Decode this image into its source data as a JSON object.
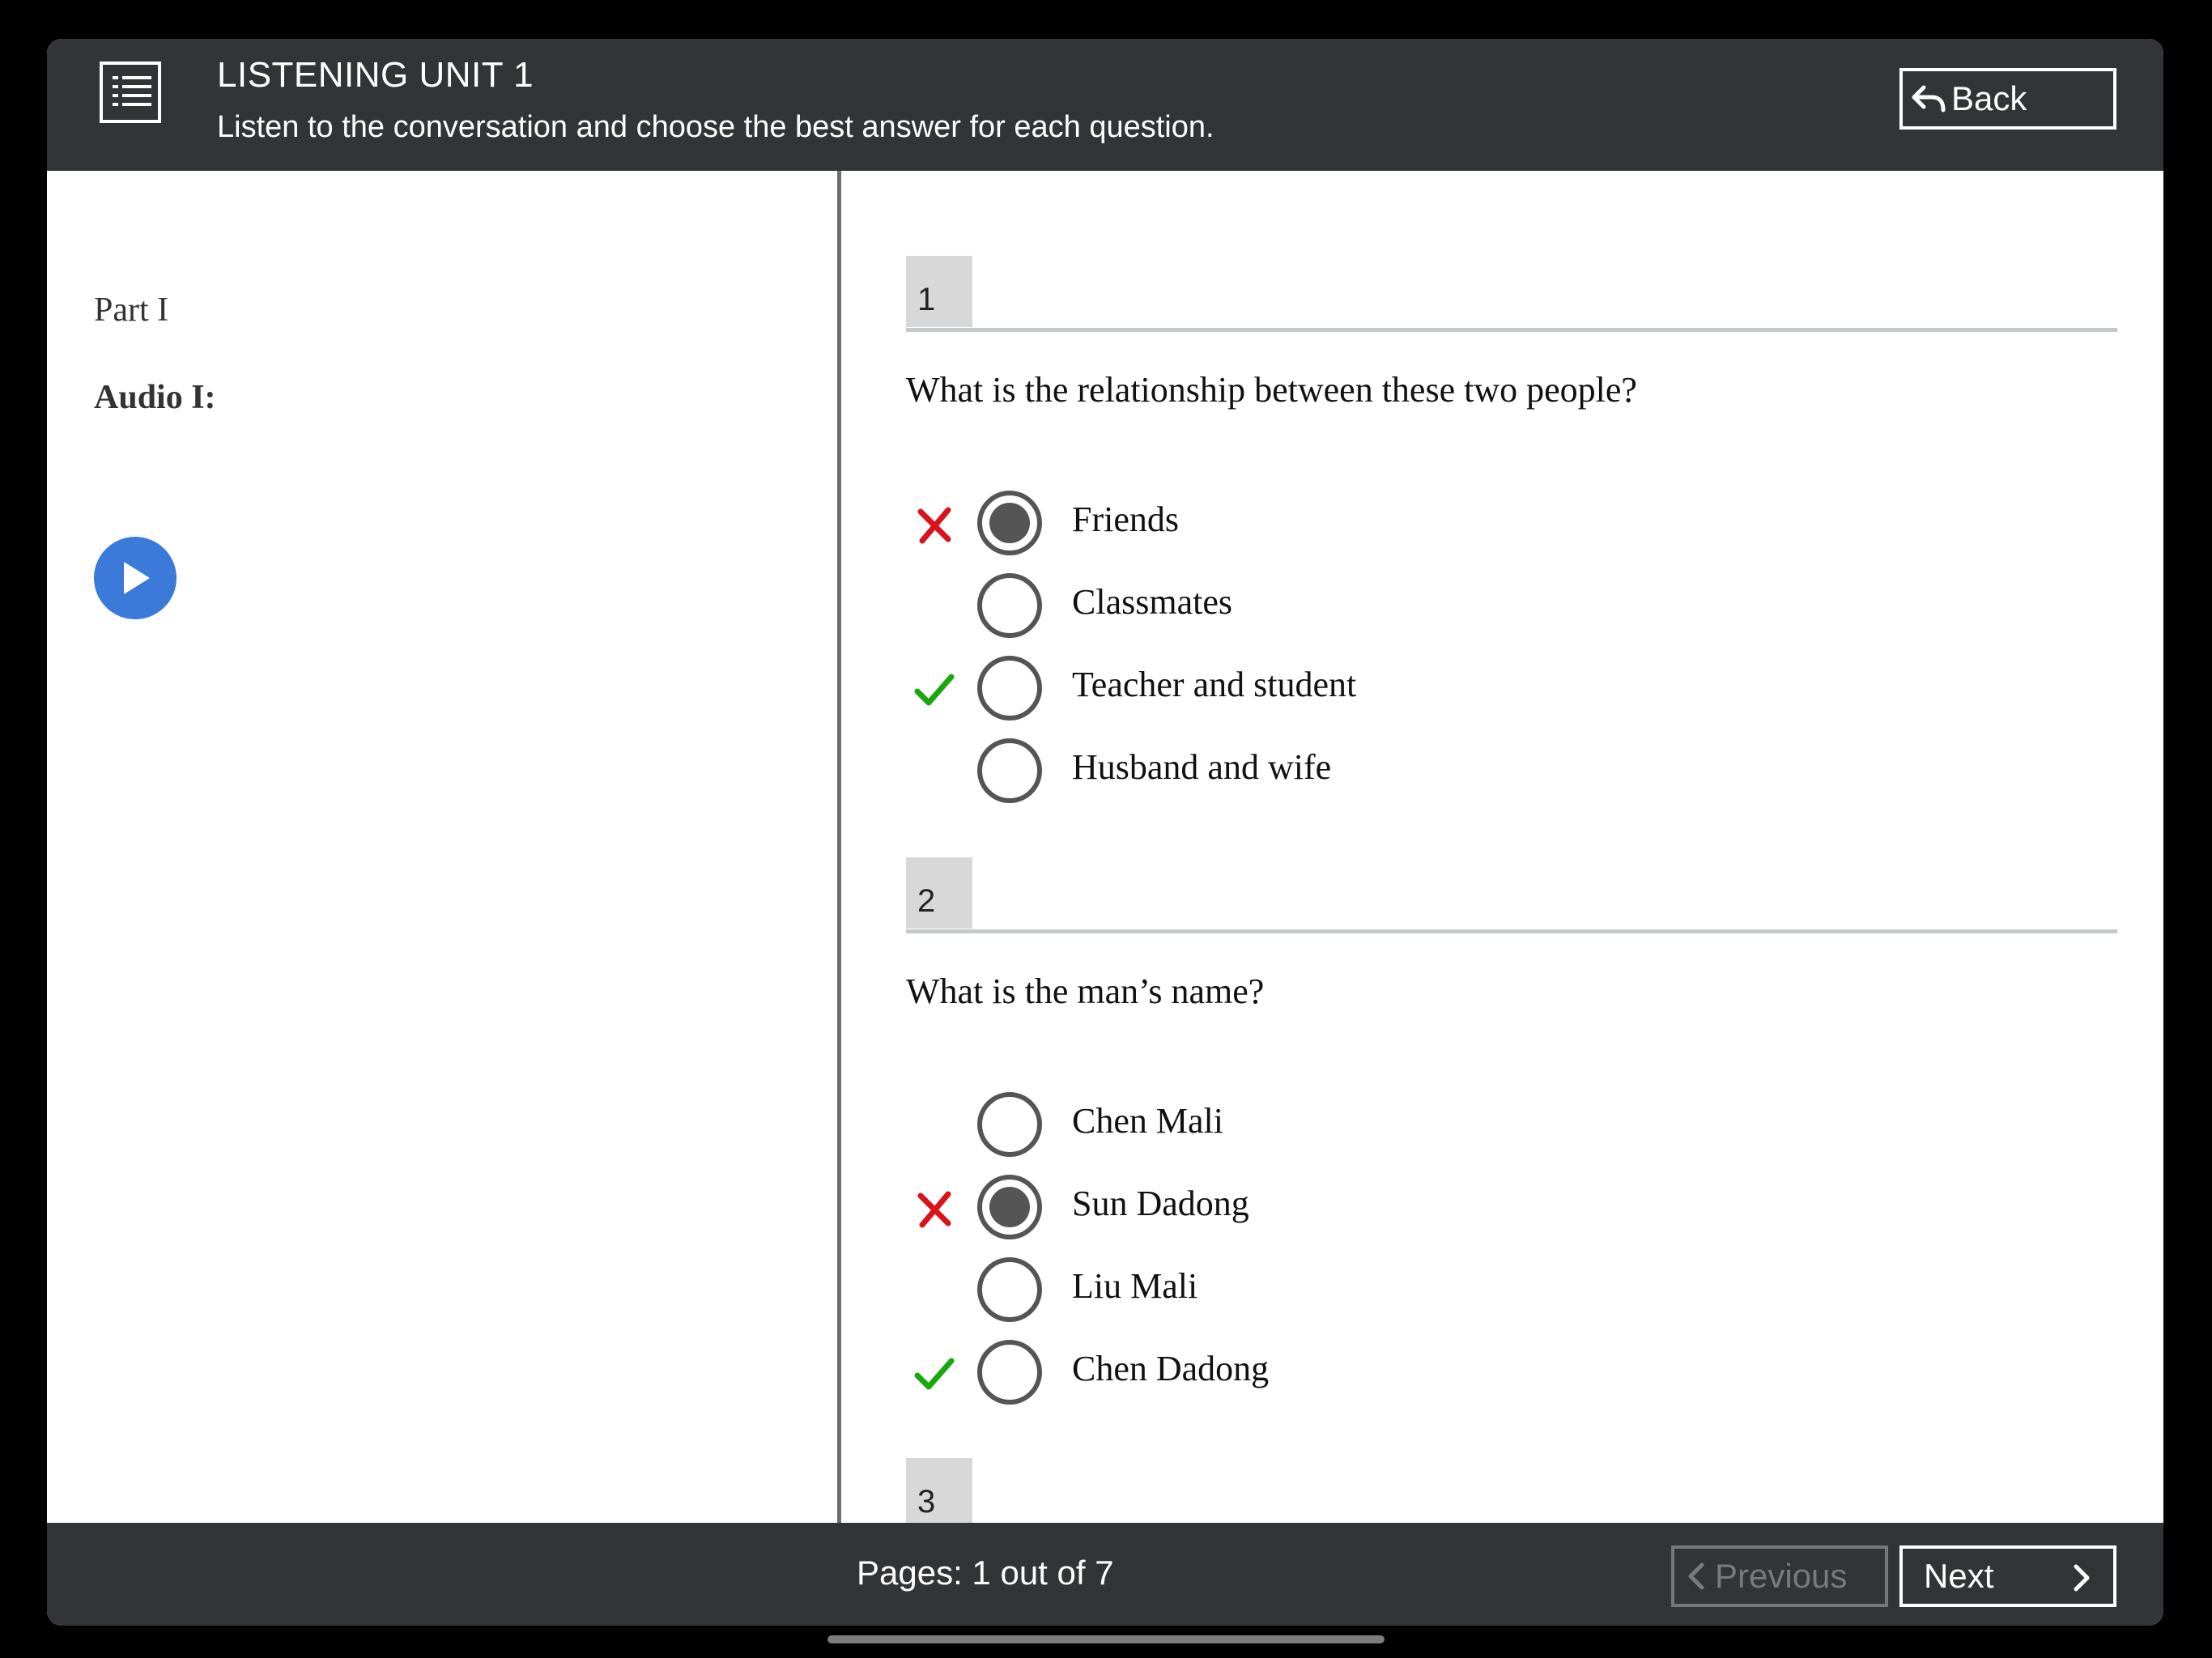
{
  "header": {
    "title": "LISTENING UNIT 1",
    "subtitle": "Listen to the conversation and choose the best answer for each question.",
    "back_label": "Back"
  },
  "left": {
    "part_label": "Part I",
    "audio_label": "Audio I:"
  },
  "questions": [
    {
      "number": "1",
      "text": "What is the relationship between these two people?",
      "options": [
        {
          "label": "Friends",
          "selected": true,
          "mark": "wrong"
        },
        {
          "label": "Classmates",
          "selected": false,
          "mark": ""
        },
        {
          "label": "Teacher and student",
          "selected": false,
          "mark": "correct"
        },
        {
          "label": "Husband and wife",
          "selected": false,
          "mark": ""
        }
      ]
    },
    {
      "number": "2",
      "text": "What is the man’s name?",
      "options": [
        {
          "label": "Chen Mali",
          "selected": false,
          "mark": ""
        },
        {
          "label": "Sun Dadong",
          "selected": true,
          "mark": "wrong"
        },
        {
          "label": "Liu Mali",
          "selected": false,
          "mark": ""
        },
        {
          "label": "Chen Dadong",
          "selected": false,
          "mark": "correct"
        }
      ]
    },
    {
      "number": "3",
      "text": "",
      "options": []
    }
  ],
  "footer": {
    "pages_text": "Pages: 1 out of 7",
    "previous_label": "Previous",
    "next_label": "Next"
  },
  "colors": {
    "bar": "#333437",
    "play": "#3b7ad8",
    "wrong": "#d9121b",
    "correct": "#19a80b"
  }
}
